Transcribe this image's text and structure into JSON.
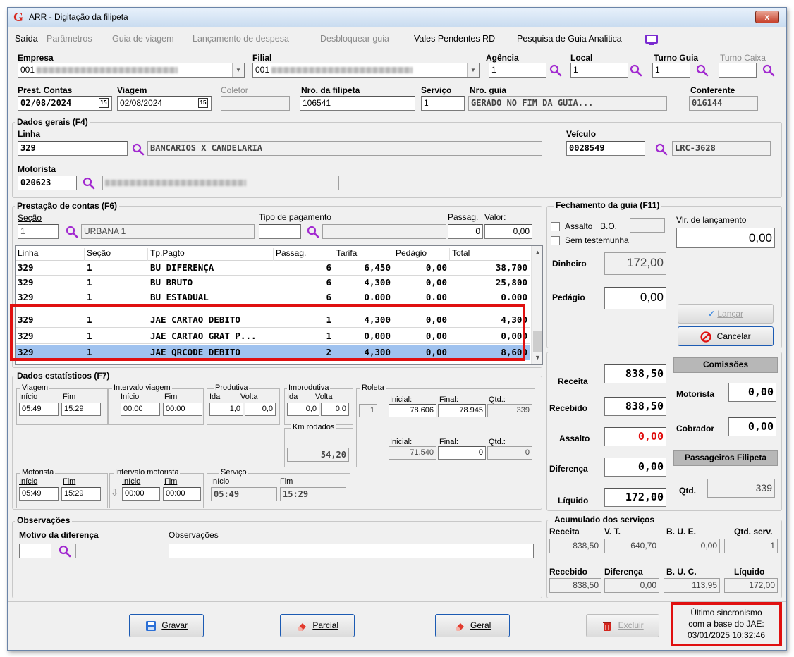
{
  "window": {
    "title": "ARR - Digitação da filipeta",
    "close_label": "x"
  },
  "menu": [
    {
      "label": "Saída",
      "enabled": true
    },
    {
      "label": "Parâmetros",
      "enabled": false
    },
    {
      "label": "Guia de viagem",
      "enabled": false
    },
    {
      "label": "Lançamento de despesa",
      "enabled": false
    },
    {
      "label": "Desbloquear guia",
      "enabled": false
    },
    {
      "label": "Vales Pendentes RD",
      "enabled": true
    },
    {
      "label": "Pesquisa de Guia Analitica",
      "enabled": true
    }
  ],
  "header": {
    "empresa_label": "Empresa",
    "empresa_value": "001",
    "filial_label": "Filial",
    "filial_value": "001",
    "agencia_label": "Agência",
    "agencia_value": "1",
    "local_label": "Local",
    "local_value": "1",
    "turno_guia_label": "Turno Guia",
    "turno_guia_value": "1",
    "turno_caixa_label": "Turno Caixa",
    "turno_caixa_value": "",
    "prest_contas_label": "Prest. Contas",
    "prest_contas_value": "02/08/2024",
    "viagem_label": "Viagem",
    "viagem_value": "02/08/2024",
    "coletor_label": "Coletor",
    "coletor_value": "",
    "nro_filipeta_label": "Nro. da filipeta",
    "nro_filipeta_value": "106541",
    "servico_label": "Serviço",
    "servico_value": "1",
    "nro_guia_label": "Nro. guia",
    "nro_guia_value": "GERADO NO FIM DA GUIA...",
    "conferente_label": "Conferente",
    "conferente_value": "016144",
    "calendar_glyph": "15"
  },
  "dados_gerais": {
    "title": "Dados gerais (F4)",
    "linha_label": "Linha",
    "linha_value": "329",
    "linha_desc": "BANCARIOS X CANDELARIA",
    "veiculo_label": "Veículo",
    "veiculo_value": "0028549",
    "veiculo_desc": "LRC-3628",
    "motorista_label": "Motorista",
    "motorista_value": "020623"
  },
  "prestacao": {
    "title": "Prestação de contas (F6)",
    "secao_label": "Seção",
    "secao_value": "1",
    "secao_desc": "URBANA 1",
    "tipo_pag_label": "Tipo de pagamento",
    "tipo_pag_value": "",
    "passag_label": "Passag.",
    "passag_value": "0",
    "valor_label": "Valor:",
    "valor_value": "0,00",
    "columns": [
      "Linha",
      "Seção",
      "Tp.Pagto",
      "Passag.",
      "Tarifa",
      "Pedágio",
      "Total"
    ],
    "rows": [
      {
        "linha": "329",
        "secao": "1",
        "tp": "BU DIFERENÇA",
        "passag": "6",
        "tarifa": "6,450",
        "pedagio": "0,00",
        "total": "38,700"
      },
      {
        "linha": "329",
        "secao": "1",
        "tp": "BU BRUTO",
        "passag": "6",
        "tarifa": "4,300",
        "pedagio": "0,00",
        "total": "25,800"
      },
      {
        "linha": "329",
        "secao": "1",
        "tp": "BU ESTADUAL",
        "passag": "6",
        "tarifa": "0,000",
        "pedagio": "0,00",
        "total": "0,000"
      },
      {
        "linha": "329",
        "secao": "1",
        "tp": "JAE CARTAO DEBITO",
        "passag": "1",
        "tarifa": "4,300",
        "pedagio": "0,00",
        "total": "4,300"
      },
      {
        "linha": "329",
        "secao": "1",
        "tp": "JAE CARTAO GRAT P...",
        "passag": "1",
        "tarifa": "0,000",
        "pedagio": "0,00",
        "total": "0,000"
      },
      {
        "linha": "329",
        "secao": "1",
        "tp": "JAE QRCODE DEBITO",
        "passag": "2",
        "tarifa": "4,300",
        "pedagio": "0,00",
        "total": "8,600"
      }
    ]
  },
  "fechamento": {
    "title": "Fechamento da guia (F11)",
    "assalto_label": "Assalto",
    "bo_label": "B.O.",
    "sem_test_label": "Sem testemunha",
    "vlr_lanc_label": "Vlr. de lançamento",
    "vlr_lanc_value": "0,00",
    "dinheiro_label": "Dinheiro",
    "dinheiro_value": "172,00",
    "pedagio_label": "Pedágio",
    "pedagio_value": "0,00",
    "lancar_label": "Lançar",
    "cancelar_label": "Cancelar"
  },
  "totais": {
    "receita_label": "Receita",
    "receita_value": "838,50",
    "recebido_label": "Recebido",
    "recebido_value": "838,50",
    "assalto_label": "Assalto",
    "assalto_value": "0,00",
    "diferenca_label": "Diferença",
    "diferenca_value": "0,00",
    "liquido_label": "Líquido",
    "liquido_value": "172,00",
    "comissoes_title": "Comissões",
    "com_motorista_label": "Motorista",
    "com_motorista_value": "0,00",
    "com_cobrador_label": "Cobrador",
    "com_cobrador_value": "0,00",
    "pass_filipeta_title": "Passageiros Filipeta",
    "qtd_label": "Qtd.",
    "qtd_value": "339",
    "accent_red": "#e01010"
  },
  "estatisticos": {
    "title": "Dados estatísticos (F7)",
    "viagem_title": "Viagem",
    "inicio_label": "Início",
    "fim_label": "Fim",
    "viagem_inicio": "05:49",
    "viagem_fim": "15:29",
    "intervalo_viagem_title": "Intervalo viagem",
    "iv_inicio": "00:00",
    "iv_fim": "00:00",
    "produtiva_title": "Produtiva",
    "ida_label": "Ida",
    "volta_label": "Volta",
    "prod_ida": "1,0",
    "prod_volta": "0,0",
    "improdutiva_title": "Improdutiva",
    "improd_ida": "0,0",
    "improd_volta": "0,0",
    "roleta_title": "Roleta",
    "roleta_num": "1",
    "inicial_label": "Inicial:",
    "final_label": "Final:",
    "qtd_label": "Qtd.:",
    "roleta1_inicial": "78.606",
    "roleta1_final": "78.945",
    "roleta1_qtd": "339",
    "roleta2_inicial": "71.540",
    "roleta2_final": "0",
    "roleta2_qtd": "0",
    "km_title": "Km rodados",
    "km_value": "54,20",
    "motorista_title": "Motorista",
    "mot_inicio": "05:49",
    "mot_fim": "15:29",
    "intervalo_mot_title": "Intervalo motorista",
    "im_inicio": "00:00",
    "im_fim": "00:00",
    "servico_title": "Serviço",
    "serv_inicio": "05:49",
    "serv_fim": "15:29"
  },
  "observacoes": {
    "title": "Observações",
    "motivo_label": "Motivo da diferença",
    "motivo_value": "",
    "obs_label": "Observações",
    "obs_value": ""
  },
  "acumulado": {
    "title": "Acumulado dos serviços",
    "receita_label": "Receita",
    "receita_value": "838,50",
    "vt_label": "V. T.",
    "vt_value": "640,70",
    "bue_label": "B. U. E.",
    "bue_value": "0,00",
    "qtd_serv_label": "Qtd. serv.",
    "qtd_serv_value": "1",
    "recebido_label": "Recebido",
    "recebido_value": "838,50",
    "diferenca_label": "Diferença",
    "diferenca_value": "0,00",
    "buc_label": "B. U. C.",
    "buc_value": "113,95",
    "liquido_label": "Líquido",
    "liquido_value": "172,00"
  },
  "buttons": {
    "gravar": "Gravar",
    "parcial": "Parcial",
    "geral": "Geral",
    "excluir": "Excluir"
  },
  "sync": {
    "line1": "Último sincronismo",
    "line2": "com a base do JAE:",
    "line3": "03/01/2025 10:32:46"
  }
}
